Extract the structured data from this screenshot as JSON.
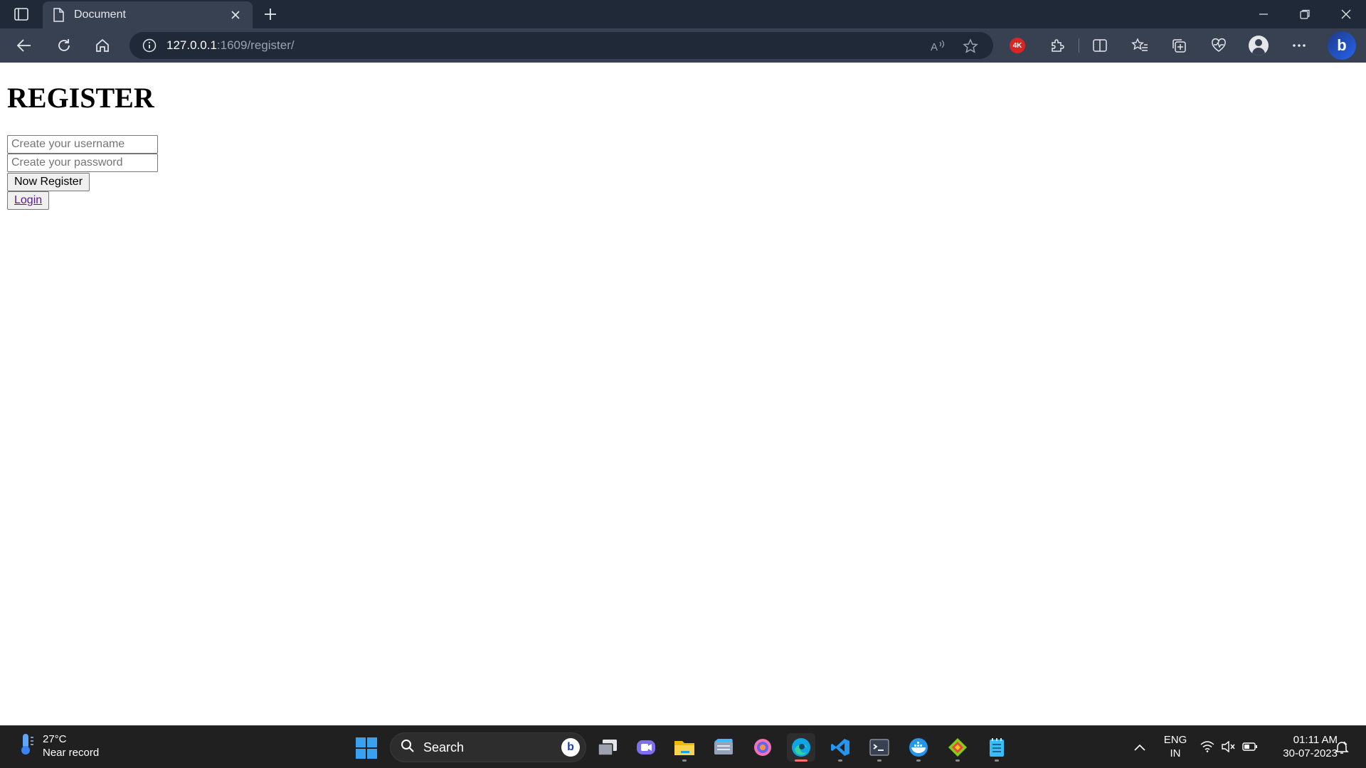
{
  "browser": {
    "tab_title": "Document",
    "url_host": "127.0.0.1",
    "url_path": ":1609/register/",
    "badge_label": "4K",
    "bing_label": "b"
  },
  "page": {
    "heading": "REGISTER",
    "username_placeholder": "Create your username",
    "password_placeholder": "Create your password",
    "register_button": "Now Register",
    "login_link": "Login"
  },
  "taskbar": {
    "weather_temp": "27°C",
    "weather_desc": "Near record",
    "search_label": "Search",
    "lang_line1": "ENG",
    "lang_line2": "IN",
    "time": "01:11 AM",
    "date": "30-07-2023",
    "apps": [
      "windows-icon",
      "task-view-icon",
      "teams-icon",
      "file-explorer-icon",
      "media-icon",
      "firefox-dev-icon",
      "edge-icon",
      "vscode-icon",
      "terminal-icon",
      "docker-icon",
      "git-icon",
      "notepad-icon"
    ]
  },
  "colors": {
    "tabbar_bg": "#1f2937",
    "toolbar_bg": "#374151",
    "taskbar_bg": "#202020",
    "link_color": "#551a8b",
    "active_app_indicator": "#f87171"
  }
}
